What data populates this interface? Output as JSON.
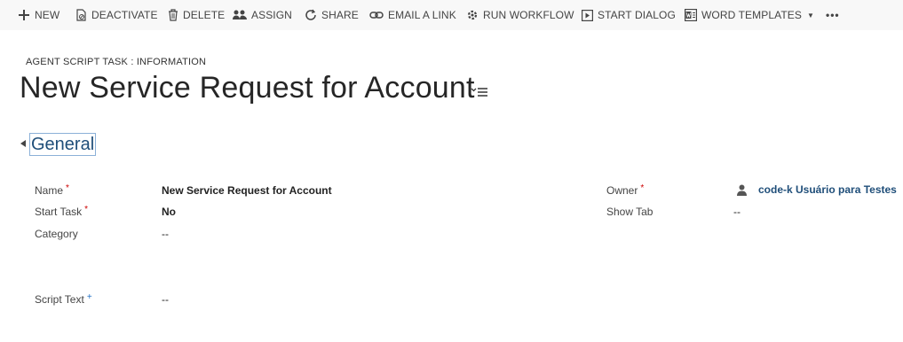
{
  "toolbar": {
    "new": "NEW",
    "deactivate": "DEACTIVATE",
    "delete": "DELETE",
    "assign": "ASSIGN",
    "share": "SHARE",
    "email_link": "EMAIL A LINK",
    "run_workflow": "RUN WORKFLOW",
    "start_dialog": "START DIALOG",
    "word_templates": "WORD TEMPLATES",
    "more": "•••"
  },
  "header": {
    "entity": "AGENT SCRIPT TASK : INFORMATION",
    "title": "New Service Request for Account"
  },
  "section": {
    "title": "General"
  },
  "fields": {
    "name": {
      "label": "Name",
      "value": "New Service Request for Account"
    },
    "start_task": {
      "label": "Start Task",
      "value": "No"
    },
    "category": {
      "label": "Category",
      "value": "--"
    },
    "script_text": {
      "label": "Script Text",
      "value": "--"
    },
    "owner": {
      "label": "Owner",
      "value": "code-k Usuário para Testes"
    },
    "show_tab": {
      "label": "Show Tab",
      "value": "--"
    }
  },
  "markers": {
    "required": "*",
    "recommended": "+"
  },
  "colors": {
    "link": "#1f4e79",
    "required": "#cc0000",
    "recommended": "#1f6fc5"
  },
  "icons": [
    "plus-icon",
    "deactivate-icon",
    "trash-icon",
    "assign-icon",
    "share-icon",
    "link-icon",
    "workflow-icon",
    "play-icon",
    "word-icon",
    "menu-icon",
    "collapse-icon",
    "user-icon"
  ]
}
